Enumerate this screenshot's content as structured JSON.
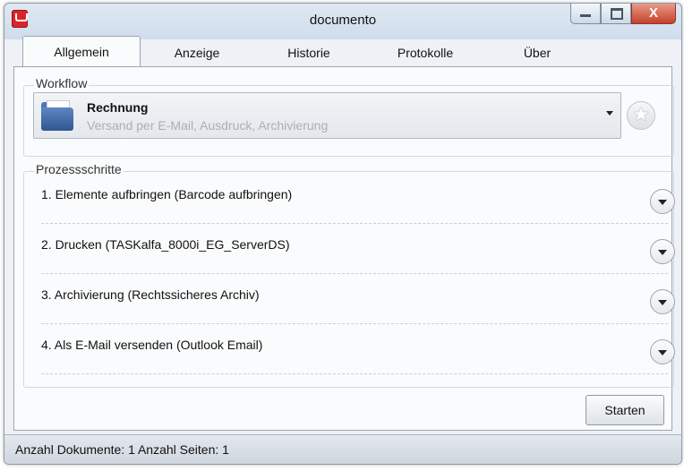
{
  "window": {
    "title": "documento",
    "close_label": "X",
    "accent_color": "#d8252b"
  },
  "tabs": [
    {
      "label": "Allgemein",
      "active": true
    },
    {
      "label": "Anzeige",
      "active": false
    },
    {
      "label": "Historie",
      "active": false
    },
    {
      "label": "Protokolle",
      "active": false
    },
    {
      "label": "Über",
      "active": false
    }
  ],
  "workflow": {
    "group_label": "Workflow",
    "selected_title": "Rechnung",
    "selected_subtitle": "Versand per E-Mail, Ausdruck, Archivierung",
    "icon": "folder-icon",
    "favorite_icon": "star-icon"
  },
  "process": {
    "group_label": "Prozessschritte",
    "steps": [
      {
        "label": "1. Elemente aufbringen (Barcode aufbringen)"
      },
      {
        "label": "2. Drucken (TASKalfa_8000i_EG_ServerDS)"
      },
      {
        "label": "3. Archivierung (Rechtssicheres Archiv)"
      },
      {
        "label": "4. Als E-Mail versenden (Outlook Email)"
      }
    ]
  },
  "actions": {
    "start_label": "Starten"
  },
  "status": {
    "text": "Anzahl Dokumente: 1  Anzahl Seiten: 1"
  }
}
